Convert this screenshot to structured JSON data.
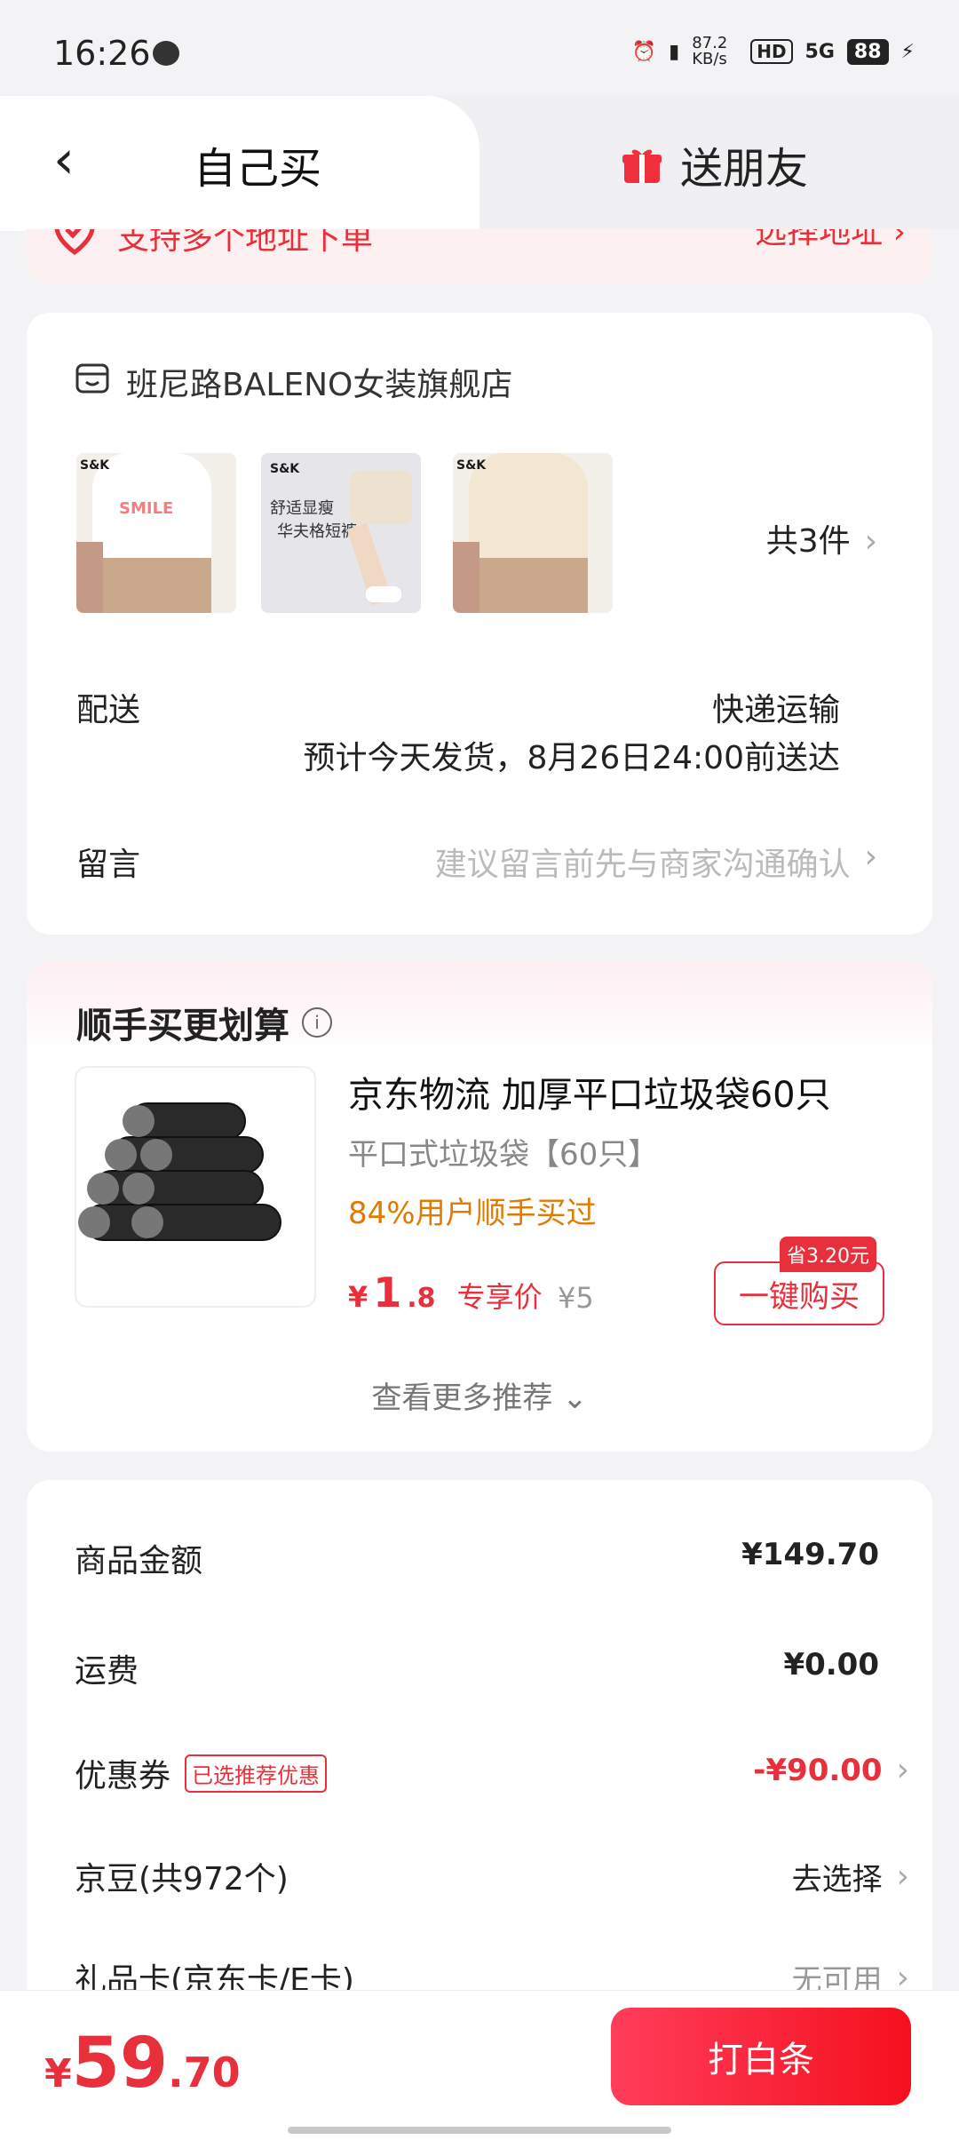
{
  "status": {
    "time": "16:26",
    "net_speed": "87.2 KB/s",
    "hd": "HD",
    "net": "5G",
    "battery": "88"
  },
  "tabs": {
    "self": "自己买",
    "gift": "送朋友"
  },
  "address": {
    "support": "支持多个地址下单",
    "select": "选择地址 ›"
  },
  "shop": {
    "name": "班尼路BALENO女装旗舰店",
    "count": "共3件",
    "thumb2_text1": "舒适显瘦",
    "thumb2_text2": "华夫格短裤",
    "brand": "S&K",
    "delivery_label": "配送",
    "delivery_method": "快递运输",
    "delivery_eta": "预计今天发货，8月26日24:00前送达",
    "note_label": "留言",
    "note_placeholder": "建议留言前先与商家沟通确认"
  },
  "recommend": {
    "title": "顺手买更划算",
    "product_title": "京东物流 加厚平口垃圾袋60只",
    "spec": "平口式垃圾袋【60只】",
    "percent": "84%用户顺手买过",
    "price_symbol": "¥",
    "price_int": "1",
    "price_dec": ".8",
    "price_label": "专享价",
    "orig_price": "¥5",
    "save": "省3.20元",
    "buy": "一键购买",
    "more": "查看更多推荐 ⌄"
  },
  "summary": {
    "goods_label": "商品金额",
    "goods_val": "¥149.70",
    "ship_label": "运费",
    "ship_val": "¥0.00",
    "coupon_label": "优惠券",
    "coupon_tag": "已选推荐优惠",
    "coupon_val": "-¥90.00",
    "beans_label": "京豆(共972个)",
    "beans_val": "去选择",
    "card_label": "礼品卡(京东卡/E卡)",
    "card_val": "无可用"
  },
  "footer": {
    "symbol": "¥",
    "int": "59",
    "dec": ".70",
    "pay": "打白条"
  },
  "colors": {
    "accent": "#e8303c",
    "orange": "#e07a00"
  }
}
